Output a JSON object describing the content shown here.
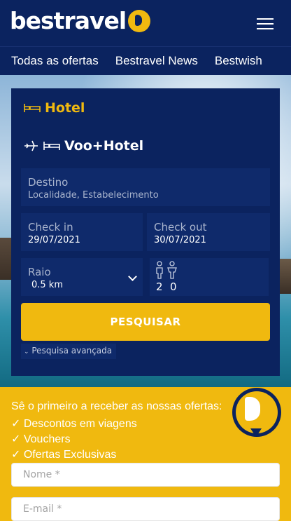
{
  "brand": {
    "name": "bestravel"
  },
  "nav": {
    "items": [
      "Todas as ofertas",
      "Bestravel News",
      "Bestwish"
    ]
  },
  "search": {
    "tab_hotel": "Hotel",
    "tab_flight_hotel": "Voo+Hotel",
    "destination": {
      "label": "Destino",
      "placeholder": "Localidade, Estabelecimento"
    },
    "checkin": {
      "label": "Check in",
      "value": "29/07/2021"
    },
    "checkout": {
      "label": "Check out",
      "value": "30/07/2021"
    },
    "radius": {
      "label": "Raio",
      "value": "0.5 km"
    },
    "adults": "2",
    "children": "0",
    "submit_label": "PESQUISAR",
    "advanced_label": "Pesquisa avançada"
  },
  "newsletter": {
    "title": "Sê o primeiro a receber as nossas ofertas:",
    "items": [
      "✓ Descontos em viagens",
      "✓ Vouchers",
      "✓ Ofertas Exclusivas"
    ],
    "name_placeholder": "Nome *",
    "email_placeholder": "E-mail *"
  },
  "colors": {
    "navy": "#0b235f",
    "accent": "#f0b90f"
  }
}
